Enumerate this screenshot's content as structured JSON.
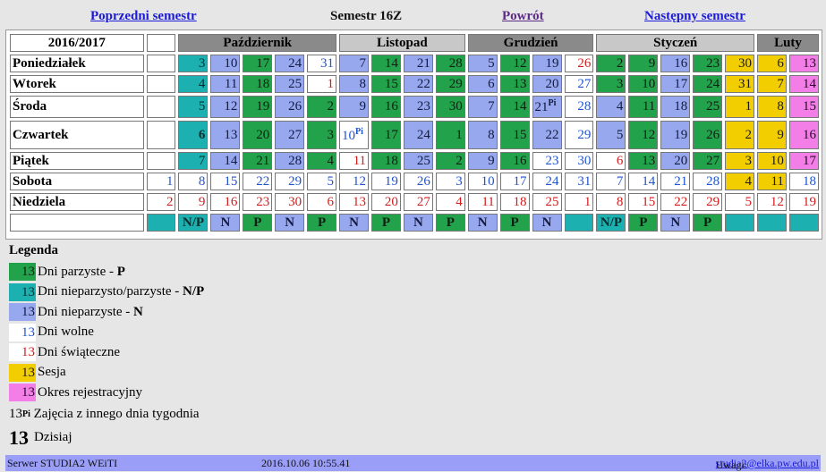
{
  "nav": {
    "prev": "Poprzedni semestr",
    "title": "Semestr 16Z",
    "back": "Powrót",
    "next": "Następny semestr"
  },
  "calendar": {
    "year_label": "2016/2017",
    "months": [
      "Październik",
      "Listopad",
      "Grudzień",
      "Styczeń",
      "Luty"
    ],
    "days": [
      "Poniedziałek",
      "Wtorek",
      "Środa",
      "Czwartek",
      "Piątek",
      "Sobota",
      "Niedziela"
    ],
    "grid": [
      [
        [
          "",
          "E"
        ],
        [
          "3",
          "NP"
        ],
        [
          "10",
          "N"
        ],
        [
          "17",
          "P"
        ],
        [
          "24",
          "N"
        ],
        [
          "31",
          "W"
        ],
        [
          "7",
          "N"
        ],
        [
          "14",
          "P"
        ],
        [
          "21",
          "N"
        ],
        [
          "28",
          "P"
        ],
        [
          "5",
          "N"
        ],
        [
          "12",
          "P"
        ],
        [
          "19",
          "N"
        ],
        [
          "26",
          "H"
        ],
        [
          "2",
          "P"
        ],
        [
          "9",
          "P"
        ],
        [
          "16",
          "N"
        ],
        [
          "23",
          "P"
        ],
        [
          "30",
          "S"
        ],
        [
          "6",
          "S"
        ],
        [
          "13",
          "R"
        ]
      ],
      [
        [
          "",
          "E"
        ],
        [
          "4",
          "NP"
        ],
        [
          "11",
          "N"
        ],
        [
          "18",
          "P"
        ],
        [
          "25",
          "N"
        ],
        [
          "1",
          "H"
        ],
        [
          "8",
          "N"
        ],
        [
          "15",
          "P"
        ],
        [
          "22",
          "N"
        ],
        [
          "29",
          "P"
        ],
        [
          "6",
          "N"
        ],
        [
          "13",
          "P"
        ],
        [
          "20",
          "N"
        ],
        [
          "27",
          "W"
        ],
        [
          "3",
          "P"
        ],
        [
          "10",
          "P"
        ],
        [
          "17",
          "N"
        ],
        [
          "24",
          "P"
        ],
        [
          "31",
          "S"
        ],
        [
          "7",
          "S"
        ],
        [
          "14",
          "R"
        ]
      ],
      [
        [
          "",
          "E"
        ],
        [
          "5",
          "NP"
        ],
        [
          "12",
          "N"
        ],
        [
          "19",
          "P"
        ],
        [
          "26",
          "N"
        ],
        [
          "2",
          "P"
        ],
        [
          "9",
          "N"
        ],
        [
          "16",
          "P"
        ],
        [
          "23",
          "N"
        ],
        [
          "30",
          "P"
        ],
        [
          "7",
          "N"
        ],
        [
          "14",
          "P"
        ],
        [
          "21",
          "N"
        ],
        [
          "28",
          "W"
        ],
        [
          "4",
          "N"
        ],
        [
          "11",
          "P"
        ],
        [
          "18",
          "N"
        ],
        [
          "25",
          "P"
        ],
        [
          "1",
          "S"
        ],
        [
          "8",
          "S"
        ],
        [
          "15",
          "R"
        ]
      ],
      [
        [
          "",
          "E"
        ],
        [
          "6",
          "NP"
        ],
        [
          "13",
          "N"
        ],
        [
          "20",
          "P"
        ],
        [
          "27",
          "N"
        ],
        [
          "3",
          "P"
        ],
        [
          "10",
          "W"
        ],
        [
          "17",
          "P"
        ],
        [
          "24",
          "N"
        ],
        [
          "1",
          "P"
        ],
        [
          "8",
          "N"
        ],
        [
          "15",
          "P"
        ],
        [
          "22",
          "N"
        ],
        [
          "29",
          "W"
        ],
        [
          "5",
          "N"
        ],
        [
          "12",
          "P"
        ],
        [
          "19",
          "N"
        ],
        [
          "26",
          "P"
        ],
        [
          "2",
          "S"
        ],
        [
          "9",
          "S"
        ],
        [
          "16",
          "R"
        ]
      ],
      [
        [
          "",
          "E"
        ],
        [
          "7",
          "NP"
        ],
        [
          "14",
          "N"
        ],
        [
          "21",
          "P"
        ],
        [
          "28",
          "N"
        ],
        [
          "4",
          "P"
        ],
        [
          "11",
          "H"
        ],
        [
          "18",
          "P"
        ],
        [
          "25",
          "N"
        ],
        [
          "2",
          "P"
        ],
        [
          "9",
          "N"
        ],
        [
          "16",
          "P"
        ],
        [
          "23",
          "W"
        ],
        [
          "30",
          "W"
        ],
        [
          "6",
          "H"
        ],
        [
          "13",
          "P"
        ],
        [
          "20",
          "N"
        ],
        [
          "27",
          "P"
        ],
        [
          "3",
          "S"
        ],
        [
          "10",
          "S"
        ],
        [
          "17",
          "R"
        ]
      ],
      [
        [
          "1",
          "W"
        ],
        [
          "8",
          "W"
        ],
        [
          "15",
          "W"
        ],
        [
          "22",
          "W"
        ],
        [
          "29",
          "W"
        ],
        [
          "5",
          "W"
        ],
        [
          "12",
          "W"
        ],
        [
          "19",
          "W"
        ],
        [
          "26",
          "W"
        ],
        [
          "3",
          "W"
        ],
        [
          "10",
          "W"
        ],
        [
          "17",
          "W"
        ],
        [
          "24",
          "W"
        ],
        [
          "31",
          "W"
        ],
        [
          "7",
          "W"
        ],
        [
          "14",
          "W"
        ],
        [
          "21",
          "W"
        ],
        [
          "28",
          "W"
        ],
        [
          "4",
          "S"
        ],
        [
          "11",
          "S"
        ],
        [
          "18",
          "W"
        ]
      ],
      [
        [
          "2",
          "H"
        ],
        [
          "9",
          "H"
        ],
        [
          "16",
          "H"
        ],
        [
          "23",
          "H"
        ],
        [
          "30",
          "H"
        ],
        [
          "6",
          "H"
        ],
        [
          "13",
          "H"
        ],
        [
          "20",
          "H"
        ],
        [
          "27",
          "H"
        ],
        [
          "4",
          "H"
        ],
        [
          "11",
          "H"
        ],
        [
          "18",
          "H"
        ],
        [
          "25",
          "H"
        ],
        [
          "1",
          "H"
        ],
        [
          "8",
          "H"
        ],
        [
          "15",
          "H"
        ],
        [
          "22",
          "H"
        ],
        [
          "29",
          "H"
        ],
        [
          "5",
          "H"
        ],
        [
          "12",
          "H"
        ],
        [
          "19",
          "H"
        ]
      ]
    ],
    "substitute_sup": "Pi",
    "week_types": [
      "",
      "N/P",
      "N",
      "P",
      "N",
      "P",
      "N",
      "P",
      "N",
      "P",
      "N",
      "P",
      "N",
      "",
      "N/P",
      "P",
      "N",
      "P",
      "",
      "",
      ""
    ]
  },
  "legend": {
    "title": "Legenda",
    "sample_day": "13",
    "items": [
      {
        "text": "Dni parzyste - ",
        "code": "P"
      },
      {
        "text": "Dni nieparzysto/parzyste - ",
        "code": "N/P"
      },
      {
        "text": "Dni nieparzyste - ",
        "code": "N"
      },
      {
        "text": "Dni wolne",
        "code": ""
      },
      {
        "text": "Dni świąteczne",
        "code": ""
      },
      {
        "text": "Sesja",
        "code": ""
      },
      {
        "text": "Okres rejestracyjny",
        "code": ""
      }
    ],
    "substitute_text": "Zajęcia z innego dnia tygodnia",
    "substitute_sup": "Pi",
    "today_text": "Dzisiaj"
  },
  "footer": {
    "server": "Serwer STUDIA2 WEiTI",
    "datetime": "2016.10.06 10:55.41",
    "remarks_label": "Uwagi:",
    "email": "studia2@elka.pw.edu.pl"
  },
  "colors": {
    "even": "#22a24a",
    "odd_even": "#1cb0b0",
    "odd": "#98a8ee",
    "free_text": "#1f54d0",
    "holiday_text": "#d21b1b",
    "session": "#f2cd00",
    "registration": "#f47ee8"
  }
}
